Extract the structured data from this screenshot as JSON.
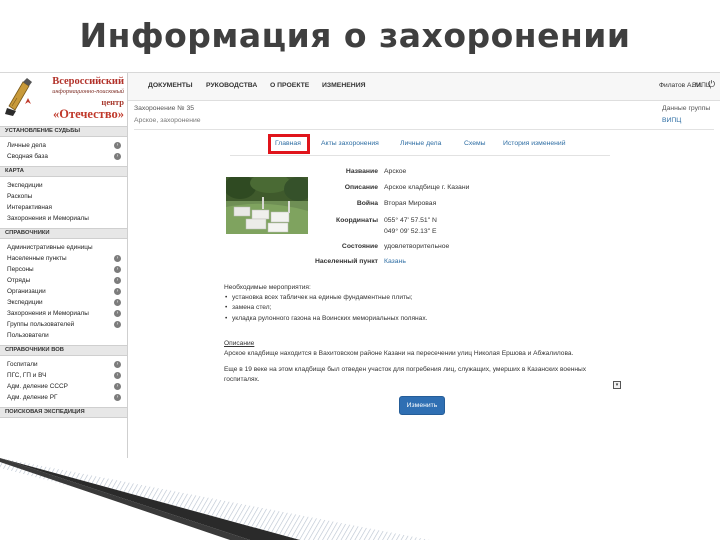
{
  "slide": {
    "title": "Информация о захоронении"
  },
  "logo": {
    "line1": "Всероссийский",
    "line2": "информационно-поисковый",
    "line3": "центр",
    "line4": "«Отечество»"
  },
  "sidebar": {
    "sections": [
      {
        "title": "УСТАНОВЛЕНИЕ СУДЬБЫ",
        "items": [
          {
            "label": "Личные дела",
            "arrow": true
          },
          {
            "label": "Сводная база",
            "arrow": true
          }
        ]
      },
      {
        "title": "КАРТА",
        "items": [
          {
            "label": "Экспедиции",
            "arrow": false
          },
          {
            "label": "Раскопы",
            "arrow": false
          },
          {
            "label": "Интерактивная",
            "arrow": false
          },
          {
            "label": "Захоронения и Мемориалы",
            "arrow": false
          }
        ]
      },
      {
        "title": "СПРАВОЧНИКИ",
        "items": [
          {
            "label": "Административные единицы",
            "arrow": false
          },
          {
            "label": "Населенные пункты",
            "arrow": true
          },
          {
            "label": "Персоны",
            "arrow": true
          },
          {
            "label": "Отряды",
            "arrow": true
          },
          {
            "label": "Организации",
            "arrow": true
          },
          {
            "label": "Экспедиции",
            "arrow": true
          },
          {
            "label": "Захоронения и Мемориалы",
            "arrow": true
          },
          {
            "label": "Группы пользователей",
            "arrow": true
          },
          {
            "label": "Пользователи",
            "arrow": false
          }
        ]
      },
      {
        "title": "СПРАВОЧНИКИ ВОВ",
        "items": [
          {
            "label": "Госпитали",
            "arrow": true
          },
          {
            "label": "ПГС, ГП и ВЧ",
            "arrow": true
          },
          {
            "label": "Адм. деление СССР",
            "arrow": true
          },
          {
            "label": "Адм. деление РГ",
            "arrow": true
          }
        ]
      },
      {
        "title": "ПОИСКОВАЯ ЭКСПЕДИЦИЯ",
        "items": []
      }
    ]
  },
  "navbar": {
    "items": [
      "ДОКУМЕНТЫ",
      "РУКОВОДСТВА",
      "О ПРОЕКТЕ",
      "ИЗМЕНЕНИЯ"
    ],
    "user": "Филатов А. М.",
    "org": "ВИПЦ",
    "power_icon": "⏻"
  },
  "record": {
    "title": "Захоронение № 35",
    "subtitle": "Арское, захоронение",
    "group_label": "Данные группы",
    "group_value": "ВИПЦ"
  },
  "tabs": [
    "Главная",
    "Акты захоронения",
    "Личные дела",
    "Схемы",
    "История изменений"
  ],
  "info": [
    {
      "label": "Название",
      "value": "Арское",
      "link": false
    },
    {
      "label": "Описание",
      "value": "Арское кладбище г. Казани",
      "link": false
    },
    {
      "label": "Война",
      "value": "Вторая Мировая",
      "link": false
    },
    {
      "label": "Координаты",
      "value": "055° 47' 57.51\" N",
      "value2": "049° 09' 52.13\" E",
      "link": false
    },
    {
      "label": "Состояние",
      "value": "удовлетворительное",
      "link": false
    },
    {
      "label": "Населенный пункт",
      "value": "Казань",
      "link": true
    }
  ],
  "needs": {
    "title": "Необходимые мероприятия:",
    "items": [
      "установка всех табличек на единые фундаментные плиты;",
      "замена стел;",
      "укладка рулонного газона на Воинских мемориальных полянах."
    ]
  },
  "description": {
    "title": "Описание",
    "line1": "Арское кладбище находится в Вахитовском районе Казани на пересечении улиц Николая Ершова и Абжалилова.",
    "line2": "Еще в 19 веке на этом кладбище был отведен участок для погребения лиц, служащих, умерших в Казанских военных госпиталях."
  },
  "buttons": {
    "edit": "Изменить"
  },
  "colors": {
    "accent": "#2f6fb3",
    "highlight": "#e0141b",
    "link": "#2d6da3"
  }
}
